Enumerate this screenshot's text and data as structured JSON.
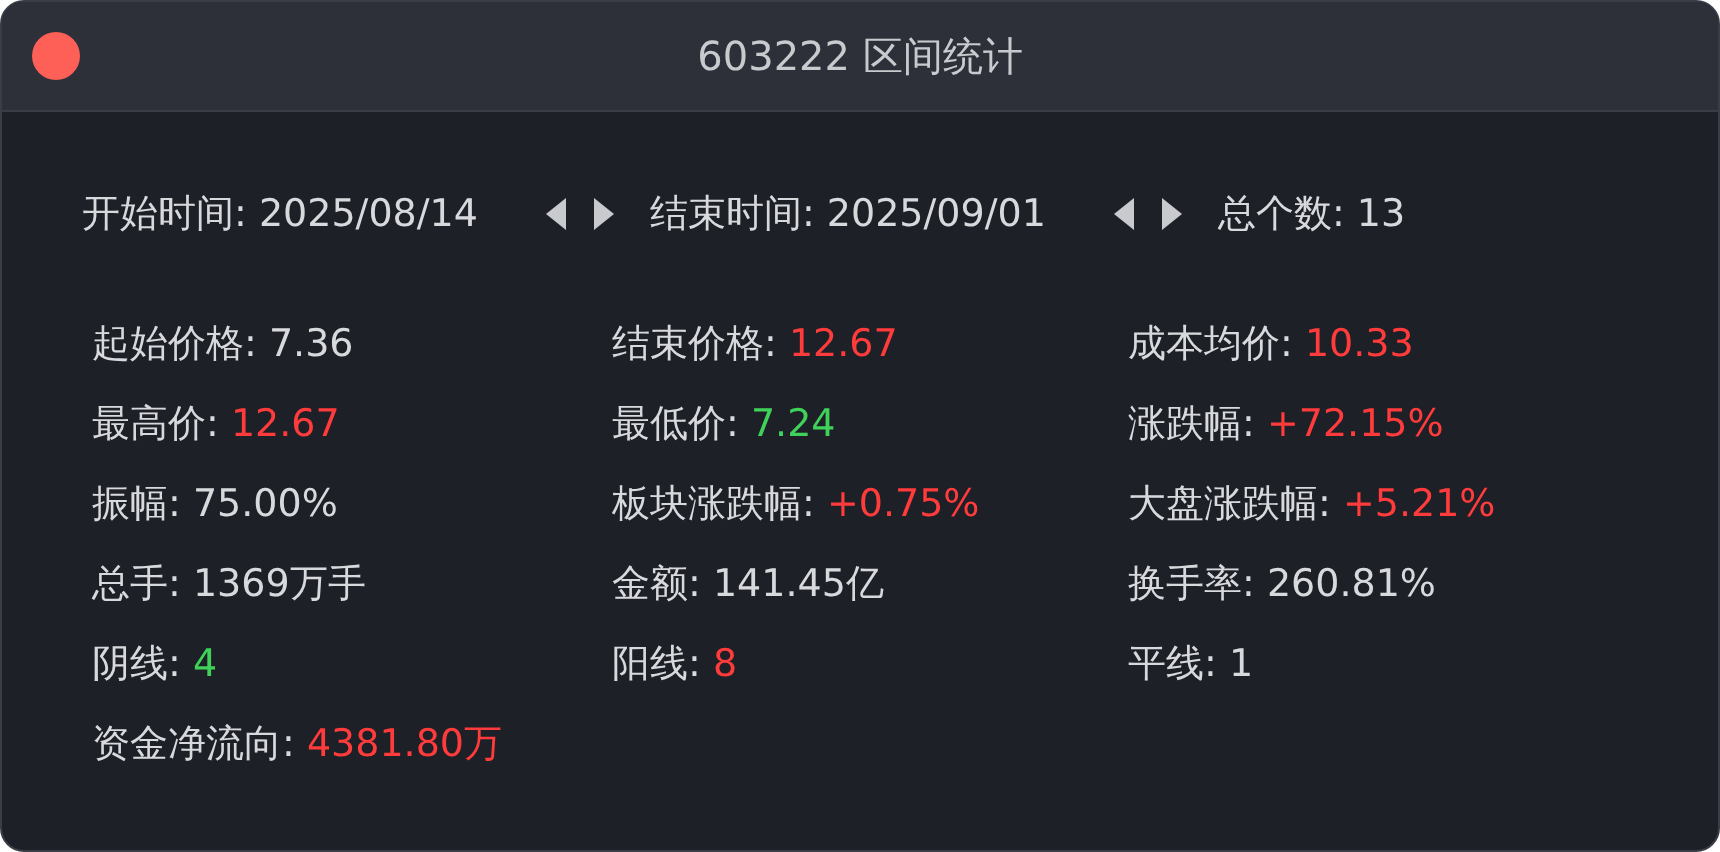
{
  "window": {
    "title": "603222 区间统计"
  },
  "range": {
    "start": {
      "label": "开始时间:",
      "value": "2025/08/14"
    },
    "end": {
      "label": "结束时间:",
      "value": "2025/09/01"
    },
    "count": {
      "label": "总个数:",
      "value": "13"
    }
  },
  "stats": [
    {
      "label": "起始价格:",
      "value": "7.36",
      "color": "#d8d9dc"
    },
    {
      "label": "结束价格:",
      "value": "12.67",
      "color": "#ff3b3b"
    },
    {
      "label": "成本均价:",
      "value": "10.33",
      "color": "#ff3b3b"
    },
    {
      "label": "最高价:",
      "value": "12.67",
      "color": "#ff3b3b"
    },
    {
      "label": "最低价:",
      "value": "7.24",
      "color": "#3fd15a"
    },
    {
      "label": "涨跌幅:",
      "value": "+72.15%",
      "color": "#ff3b3b"
    },
    {
      "label": "振幅:",
      "value": "75.00%",
      "color": "#d8d9dc"
    },
    {
      "label": "板块涨跌幅:",
      "value": "+0.75%",
      "color": "#ff3b3b"
    },
    {
      "label": "大盘涨跌幅:",
      "value": "+5.21%",
      "color": "#ff3b3b"
    },
    {
      "label": "总手:",
      "value": "1369万手",
      "color": "#d8d9dc"
    },
    {
      "label": "金额:",
      "value": "141.45亿",
      "color": "#d8d9dc"
    },
    {
      "label": "换手率:",
      "value": "260.81%",
      "color": "#d8d9dc"
    },
    {
      "label": "阴线:",
      "value": "4",
      "color": "#3fd15a"
    },
    {
      "label": "阳线:",
      "value": "8",
      "color": "#ff3b3b"
    },
    {
      "label": "平线:",
      "value": "1",
      "color": "#d8d9dc"
    },
    {
      "label": "资金净流向:",
      "value": "4381.80万",
      "color": "#ff3b3b"
    }
  ]
}
